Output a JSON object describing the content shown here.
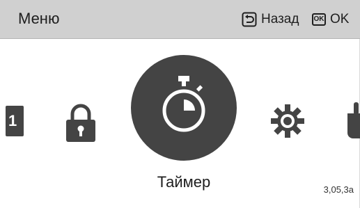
{
  "header": {
    "title": "Меню",
    "back_label": "Назад",
    "ok_label": "OK",
    "ok_icon_text": "OK"
  },
  "carousel": {
    "left_edge_text": "1",
    "items": [
      {
        "icon": "lock-icon"
      },
      {
        "icon": "stopwatch-icon",
        "label": "Таймер",
        "selected": true
      },
      {
        "icon": "gear-icon"
      }
    ]
  },
  "footer": {
    "version": "3,05,3a"
  },
  "colors": {
    "header_bg": "#d0d0d0",
    "icon": "#444444",
    "text": "#1e1e1e"
  }
}
